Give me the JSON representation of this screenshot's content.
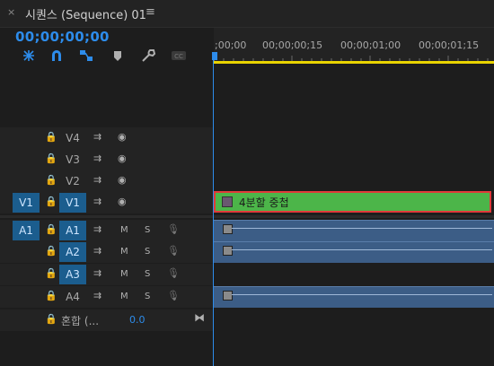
{
  "panel": {
    "close_glyph": "×",
    "title": "시퀀스 (Sequence) 01",
    "menu_glyph": "≡"
  },
  "timecode": "00;00;00;00",
  "tools": [
    "nest-icon",
    "snap-magnet-icon",
    "linked-selection-icon",
    "marker-icon",
    "wrench-icon",
    "captions-icon"
  ],
  "ruler": {
    "labels": [
      ";00;00",
      "00;00;00;15",
      "00;00;01;00",
      "00;00;01;15"
    ]
  },
  "video_tracks": [
    {
      "name": "V4",
      "source": "",
      "lock": "🔒",
      "sync": "⇉",
      "eye": "◉"
    },
    {
      "name": "V3",
      "source": "",
      "lock": "🔒",
      "sync": "⇉",
      "eye": "◉"
    },
    {
      "name": "V2",
      "source": "",
      "lock": "🔒",
      "sync": "⇉",
      "eye": "◉"
    },
    {
      "name": "V1",
      "source": "V1",
      "lock": "🔒",
      "sync": "⇉",
      "eye": "◉"
    }
  ],
  "audio_tracks": [
    {
      "name": "A1",
      "source": "A1",
      "m": "M",
      "s": "S"
    },
    {
      "name": "A2",
      "source": "",
      "m": "M",
      "s": "S"
    },
    {
      "name": "A3",
      "source": "",
      "m": "M",
      "s": "S"
    },
    {
      "name": "A4",
      "source": "",
      "m": "M",
      "s": "S"
    }
  ],
  "mix": {
    "label": "혼합 (...",
    "value": "0.0",
    "end_glyph": "⧓"
  },
  "video_clip": {
    "name": "4분할 중첩"
  },
  "colors": {
    "accent": "#2d8ceb",
    "clip_video": "#4cb549",
    "clip_audio": "#3c5d86",
    "selection": "#e03a3a",
    "work_bar": "#e9d300"
  }
}
